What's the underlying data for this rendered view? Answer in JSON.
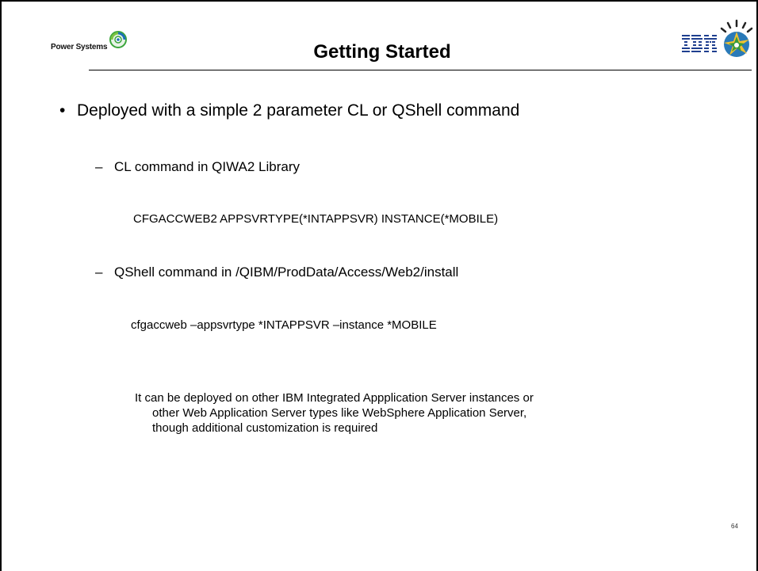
{
  "header": {
    "brand_text": "Power Systems",
    "brand_icon": "power-systems-swirl-icon",
    "title": "Getting Started",
    "logo_text": "IBM",
    "logo_burst_icon": "ibm-smarter-planet-burst-icon"
  },
  "body": {
    "bullet_mark": "•",
    "bullet_text": "Deployed with a simple 2 parameter CL or QShell command",
    "sub_mark": "–",
    "sub_items": [
      {
        "label": "CL command in QIWA2 Library",
        "command": "CFGACCWEB2 APPSVRTYPE(*INTAPPSVR) INSTANCE(*MOBILE)"
      },
      {
        "label": "QShell command in /QIBM/ProdData/Access/Web2/install",
        "command": "cfgaccweb –appsvrtype *INTAPPSVR –instance *MOBILE"
      }
    ],
    "note_lines": [
      "It can be deployed on other IBM Integrated Appplication Server instances or",
      "other Web Application Server types like WebSphere Application Server,",
      "though additional customization is required"
    ]
  },
  "footer": {
    "page_number": "64"
  },
  "colors": {
    "ibm_blue": "#1f3f8f",
    "brand_green": "#3aa53a",
    "brand_blue": "#1c6fb7"
  }
}
